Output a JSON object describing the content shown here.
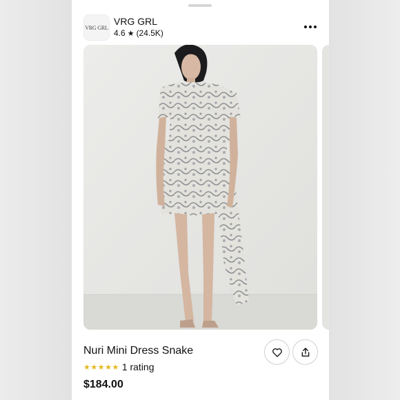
{
  "shop": {
    "logo_text": "VRG GRL",
    "name": "VRG GRL",
    "rating": "4.6",
    "review_count": "(24.5K)"
  },
  "product": {
    "title": "Nuri Mini Dress Snake",
    "stars": "★★★★★",
    "rating_label": "1 rating",
    "price": "$184.00"
  },
  "icons": {
    "more": "more-horizontal-icon",
    "favorite": "heart-icon",
    "share": "share-icon",
    "rating_star": "star-icon"
  },
  "colors": {
    "star_yellow": "#e4b81e",
    "text": "#111111",
    "photo_background": "#e6e6e3"
  }
}
